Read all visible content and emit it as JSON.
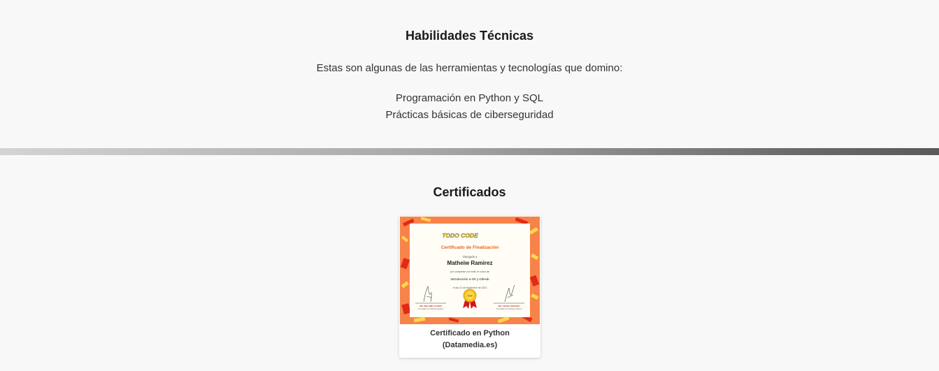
{
  "skills": {
    "title": "Habilidades Técnicas",
    "intro": "Estas son algunas de las herramientas y tecnologías que domino:",
    "items": [
      "Programación en Python y SQL",
      "Prácticas básicas de ciberseguridad"
    ]
  },
  "certificates": {
    "title": "Certificados",
    "cards": [
      {
        "caption_line1": "Certificado en Python",
        "caption_line2": "(Datamedia.es)",
        "image": {
          "logo_text": "TODO CODE",
          "heading": "Certificado de Finalización",
          "granted_to_label": "Otorgado a",
          "recipient": "Matheiw Ramirez",
          "completed_label": "por completar con éxito el curso de",
          "course": "Introducción a Git y GitHub",
          "date_line": "el día 22 de Noviembre de 2023",
          "signer_left": "ING. MELANIE CLAROS",
          "signer_left_role": "Co-fundador de TodoCode Academy",
          "signer_right": "ING. FELIPE TERCERO",
          "signer_right_role": "Co-fundador de TodoCode Academy",
          "medal_text": "2023"
        }
      }
    ]
  },
  "colors": {
    "cert_background": "#f7834a",
    "cert_accent_red": "#e02a1a",
    "cert_accent_yellow": "#ffd84a",
    "cert_heading": "#e8641d"
  }
}
